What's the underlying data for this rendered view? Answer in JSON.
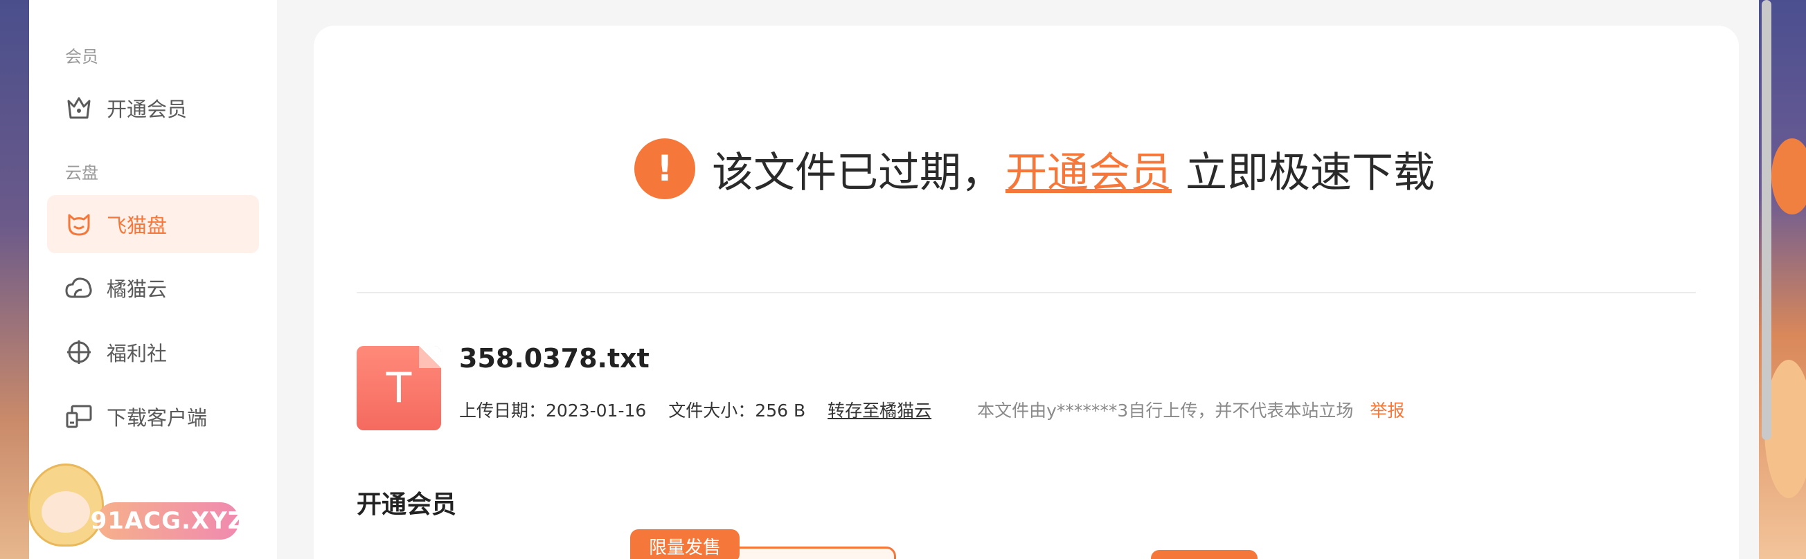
{
  "sidebar": {
    "section_vip": "会员",
    "section_cloud": "云盘",
    "items": [
      {
        "label": "开通会员",
        "icon": "crown-icon"
      },
      {
        "label": "飞猫盘",
        "icon": "cat-icon"
      },
      {
        "label": "橘猫云",
        "icon": "cloud-icon"
      },
      {
        "label": "福利社",
        "icon": "pinwheel-icon"
      },
      {
        "label": "下载客户端",
        "icon": "desktop-icon"
      }
    ],
    "mascot_text": "91ACG.XYZ"
  },
  "notice": {
    "prefix": "该文件已过期，",
    "link": "开通会员",
    "suffix": "立即极速下载"
  },
  "file": {
    "icon_letter": "T",
    "name": "358.0378.txt",
    "upload_date": "上传日期：2023-01-16",
    "size": "文件大小：256 B",
    "save_link": "转存至橘猫云",
    "disclaimer": "本文件由y*******3自行上传，并不代表本站立场",
    "report": "举报"
  },
  "vip": {
    "heading": "开通会员",
    "badge": "限量发售"
  },
  "colors": {
    "accent": "#f5783a",
    "active_bg": "#fff0ea",
    "file_icon": "#f56a5f"
  }
}
